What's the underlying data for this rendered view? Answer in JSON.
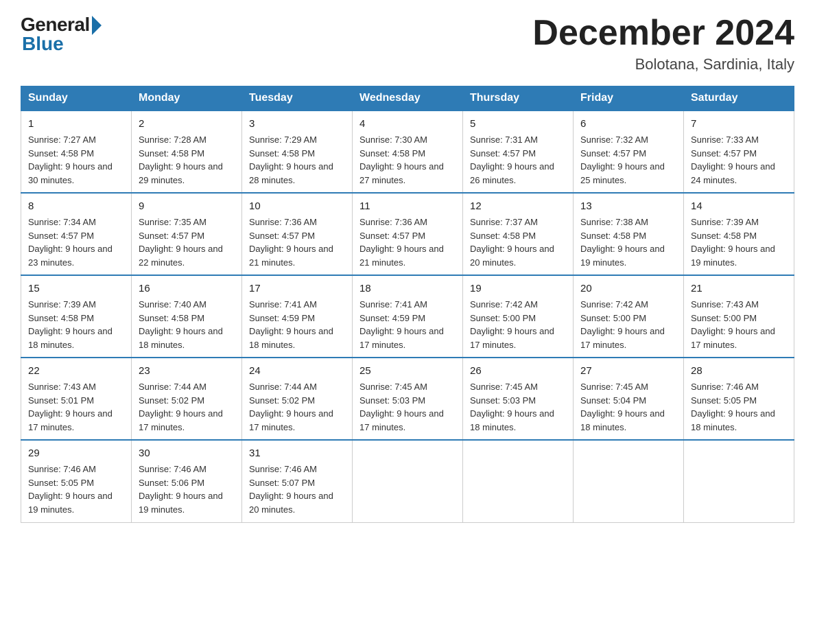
{
  "logo": {
    "general": "General",
    "blue": "Blue"
  },
  "header": {
    "month": "December 2024",
    "location": "Bolotana, Sardinia, Italy"
  },
  "weekdays": [
    "Sunday",
    "Monday",
    "Tuesday",
    "Wednesday",
    "Thursday",
    "Friday",
    "Saturday"
  ],
  "weeks": [
    [
      {
        "day": "1",
        "sunrise": "7:27 AM",
        "sunset": "4:58 PM",
        "daylight": "9 hours and 30 minutes."
      },
      {
        "day": "2",
        "sunrise": "7:28 AM",
        "sunset": "4:58 PM",
        "daylight": "9 hours and 29 minutes."
      },
      {
        "day": "3",
        "sunrise": "7:29 AM",
        "sunset": "4:58 PM",
        "daylight": "9 hours and 28 minutes."
      },
      {
        "day": "4",
        "sunrise": "7:30 AM",
        "sunset": "4:58 PM",
        "daylight": "9 hours and 27 minutes."
      },
      {
        "day": "5",
        "sunrise": "7:31 AM",
        "sunset": "4:57 PM",
        "daylight": "9 hours and 26 minutes."
      },
      {
        "day": "6",
        "sunrise": "7:32 AM",
        "sunset": "4:57 PM",
        "daylight": "9 hours and 25 minutes."
      },
      {
        "day": "7",
        "sunrise": "7:33 AM",
        "sunset": "4:57 PM",
        "daylight": "9 hours and 24 minutes."
      }
    ],
    [
      {
        "day": "8",
        "sunrise": "7:34 AM",
        "sunset": "4:57 PM",
        "daylight": "9 hours and 23 minutes."
      },
      {
        "day": "9",
        "sunrise": "7:35 AM",
        "sunset": "4:57 PM",
        "daylight": "9 hours and 22 minutes."
      },
      {
        "day": "10",
        "sunrise": "7:36 AM",
        "sunset": "4:57 PM",
        "daylight": "9 hours and 21 minutes."
      },
      {
        "day": "11",
        "sunrise": "7:36 AM",
        "sunset": "4:57 PM",
        "daylight": "9 hours and 21 minutes."
      },
      {
        "day": "12",
        "sunrise": "7:37 AM",
        "sunset": "4:58 PM",
        "daylight": "9 hours and 20 minutes."
      },
      {
        "day": "13",
        "sunrise": "7:38 AM",
        "sunset": "4:58 PM",
        "daylight": "9 hours and 19 minutes."
      },
      {
        "day": "14",
        "sunrise": "7:39 AM",
        "sunset": "4:58 PM",
        "daylight": "9 hours and 19 minutes."
      }
    ],
    [
      {
        "day": "15",
        "sunrise": "7:39 AM",
        "sunset": "4:58 PM",
        "daylight": "9 hours and 18 minutes."
      },
      {
        "day": "16",
        "sunrise": "7:40 AM",
        "sunset": "4:58 PM",
        "daylight": "9 hours and 18 minutes."
      },
      {
        "day": "17",
        "sunrise": "7:41 AM",
        "sunset": "4:59 PM",
        "daylight": "9 hours and 18 minutes."
      },
      {
        "day": "18",
        "sunrise": "7:41 AM",
        "sunset": "4:59 PM",
        "daylight": "9 hours and 17 minutes."
      },
      {
        "day": "19",
        "sunrise": "7:42 AM",
        "sunset": "5:00 PM",
        "daylight": "9 hours and 17 minutes."
      },
      {
        "day": "20",
        "sunrise": "7:42 AM",
        "sunset": "5:00 PM",
        "daylight": "9 hours and 17 minutes."
      },
      {
        "day": "21",
        "sunrise": "7:43 AM",
        "sunset": "5:00 PM",
        "daylight": "9 hours and 17 minutes."
      }
    ],
    [
      {
        "day": "22",
        "sunrise": "7:43 AM",
        "sunset": "5:01 PM",
        "daylight": "9 hours and 17 minutes."
      },
      {
        "day": "23",
        "sunrise": "7:44 AM",
        "sunset": "5:02 PM",
        "daylight": "9 hours and 17 minutes."
      },
      {
        "day": "24",
        "sunrise": "7:44 AM",
        "sunset": "5:02 PM",
        "daylight": "9 hours and 17 minutes."
      },
      {
        "day": "25",
        "sunrise": "7:45 AM",
        "sunset": "5:03 PM",
        "daylight": "9 hours and 17 minutes."
      },
      {
        "day": "26",
        "sunrise": "7:45 AM",
        "sunset": "5:03 PM",
        "daylight": "9 hours and 18 minutes."
      },
      {
        "day": "27",
        "sunrise": "7:45 AM",
        "sunset": "5:04 PM",
        "daylight": "9 hours and 18 minutes."
      },
      {
        "day": "28",
        "sunrise": "7:46 AM",
        "sunset": "5:05 PM",
        "daylight": "9 hours and 18 minutes."
      }
    ],
    [
      {
        "day": "29",
        "sunrise": "7:46 AM",
        "sunset": "5:05 PM",
        "daylight": "9 hours and 19 minutes."
      },
      {
        "day": "30",
        "sunrise": "7:46 AM",
        "sunset": "5:06 PM",
        "daylight": "9 hours and 19 minutes."
      },
      {
        "day": "31",
        "sunrise": "7:46 AM",
        "sunset": "5:07 PM",
        "daylight": "9 hours and 20 minutes."
      },
      null,
      null,
      null,
      null
    ]
  ]
}
